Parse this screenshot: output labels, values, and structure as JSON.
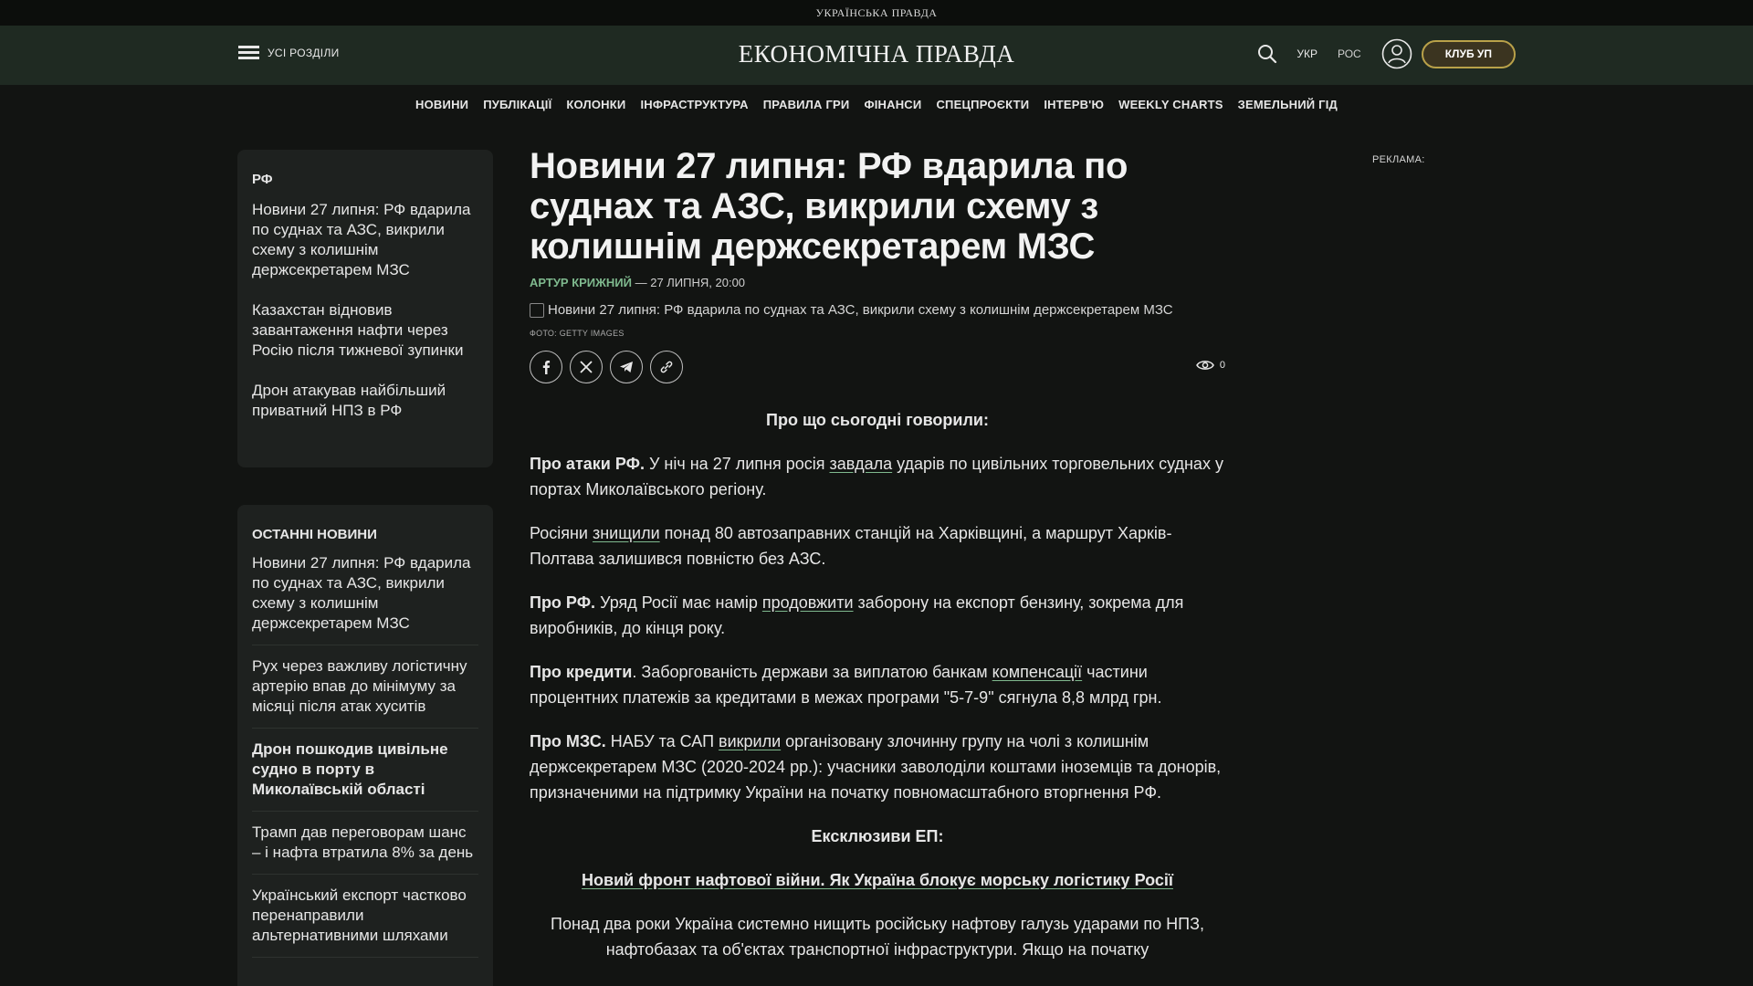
{
  "topbar": {
    "brand": "УКРАЇНСЬКА ПРАВДА"
  },
  "header": {
    "menu_label": "УСІ РОЗДІЛИ",
    "logo": "ЕКОНОМІЧНА ПРАВДА",
    "lang_ukr": "УКР",
    "lang_ros": "РОС",
    "club_label": "КЛУБ УП"
  },
  "nav": [
    "НОВИНИ",
    "ПУБЛІКАЦІЇ",
    "КОЛОНКИ",
    "ІНФРАСТРУКТУРА",
    "ПРАВИЛА ГРИ",
    "ФІНАНСИ",
    "СПЕЦПРОЄКТИ",
    "ІНТЕРВ'Ю",
    "WEEKLY CHARTS",
    "ЗЕМЕЛЬНИЙ ГІД"
  ],
  "related": {
    "tag": "РФ",
    "items": [
      "Новини 27 липня: РФ вдарила по суднах та АЗС, викрили схему з колишнім держсекретарем МЗС",
      "Казахстан відновив завантаження нафти через Росію після тижневої зупинки",
      "Дрон атакував найбільший приватний НПЗ в РФ"
    ]
  },
  "latest": {
    "heading": "ОСТАННІ НОВИНИ",
    "items": [
      "Новини 27 липня: РФ вдарила по суднах та АЗС, викрили схему з колишнім держсекретарем МЗС",
      "Рух через важливу логістичну артерію впав до мінімуму за місяці після атак хуситів",
      "Дрон пошкодив цивільне судно в порту в Миколаївській області",
      "Трамп дав переговорам шанс – і нафта втратила 8% за день",
      "Український експорт частково перенаправили альтернативними шляхами"
    ]
  },
  "article": {
    "title": "Новини 27 липня: РФ вдарила по суднах та АЗС, викрили схему з колишнім держсекретарем МЗС",
    "author": "АРТУР КРИЖНИЙ",
    "date": " — 27 ЛИПНЯ, 20:00",
    "image_alt": "Новини 27 липня: РФ вдарила по суднах та АЗС, викрили схему з колишнім держсекретарем МЗС",
    "photo_credit": "ФОТО: GETTY IMAGES",
    "views": "0",
    "intro": "Про що сьогодні говорили:",
    "p1": {
      "lead": "Про атаки РФ.",
      "a": " У ніч на 27 липня росія ",
      "link": "завдала",
      "b": " ударів по цивільних торговельних суднах у портах Миколаївського регіону."
    },
    "p2": {
      "a": "Росіяни ",
      "link": "знищили",
      "b": " понад 80 автозаправних станцій на Харківщині, а маршрут Харків-Полтава залишився повністю без АЗС."
    },
    "p3": {
      "lead": "Про РФ.",
      "a": " Уряд Росії має намір ",
      "link": "продовжити",
      "b": " заборону на експорт бензину, зокрема для виробників, до кінця року."
    },
    "p4": {
      "lead": "Про кредити",
      "a": ". Заборгованість держави за виплатою банкам ",
      "link": "компенсації",
      "b": " частини процентних платежів за кредитами в межах програми \"5-7-9\" сягнула 8,8 млрд грн."
    },
    "p5": {
      "lead": "Про МЗС.",
      "a": " НАБУ та САП ",
      "link": "викрили",
      "b": " організовану злочинну групу на чолі з колишнім держсекретарем МЗС (2020-2024 рр.): учасники заволоділи коштами іноземців та донорів, призначеними на підтримку України на початку повномасштабного вторгнення РФ."
    },
    "exclusives": "Ексклюзиви ЕП:",
    "exclusive_link": "Новий фронт нафтової війни. Як Україна блокує морську логістику Росії",
    "exclusive_text": "Понад два роки Україна системно нищить російську нафтову галузь ударами по НПЗ, нафтобазах та об'єктах транспортної інфраструктури. Якщо на початку"
  },
  "ad_label": "РЕКЛАМА:"
}
